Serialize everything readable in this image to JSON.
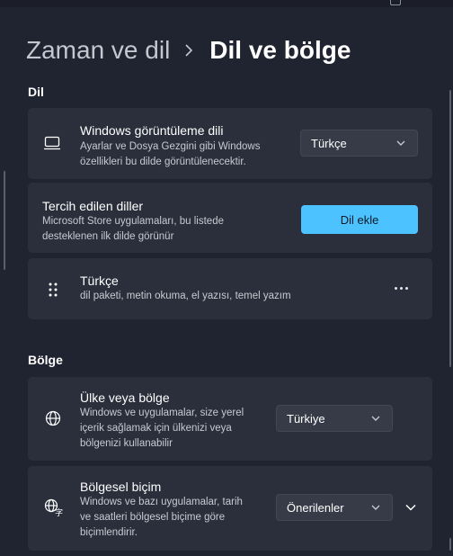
{
  "breadcrumb": {
    "parent": "Zaman ve dil",
    "current": "Dil ve bölge"
  },
  "language_section": {
    "title": "Dil",
    "display_language": {
      "icon": "monitor-icon",
      "title": "Windows görüntüleme dili",
      "desc_line1": "Ayarlar ve Dosya Gezgini gibi Windows",
      "desc_line2": "özellikleri bu dilde görüntülenecektir.",
      "value": "Türkçe"
    },
    "preferred_languages": {
      "title": "Tercih edilen diller",
      "desc_line1": "Microsoft Store uygulamaları, bu listede",
      "desc_line2": "desteklenen ilk dilde görünür",
      "button_label": "Dil ekle"
    },
    "language_item": {
      "icon": "drag-handle-icon",
      "title": "Türkçe",
      "desc": "dil paketi, metin okuma, el yazısı, temel yazım",
      "more_icon": "more-icon"
    }
  },
  "region_section": {
    "title": "Bölge",
    "country": {
      "icon": "globe-icon",
      "title": "Ülke veya bölge",
      "desc_line1": "Windows ve uygulamalar, size yerel",
      "desc_line2": "içerik sağlamak için ülkenizi veya",
      "desc_line3": "bölgenizi kullanabilir",
      "value": "Türkiye"
    },
    "regional_format": {
      "icon": "regional-format-icon",
      "title": "Bölgesel biçim",
      "desc_line1": "Windows ve bazı uygulamalar, tarih",
      "desc_line2": "ve saatleri bölgesel biçime göre",
      "desc_line3": "biçimlendirir.",
      "value": "Önerilenler"
    }
  },
  "colors": {
    "accent": "#4cc2ff",
    "background": "#202431",
    "card": "#2b2f3b"
  }
}
